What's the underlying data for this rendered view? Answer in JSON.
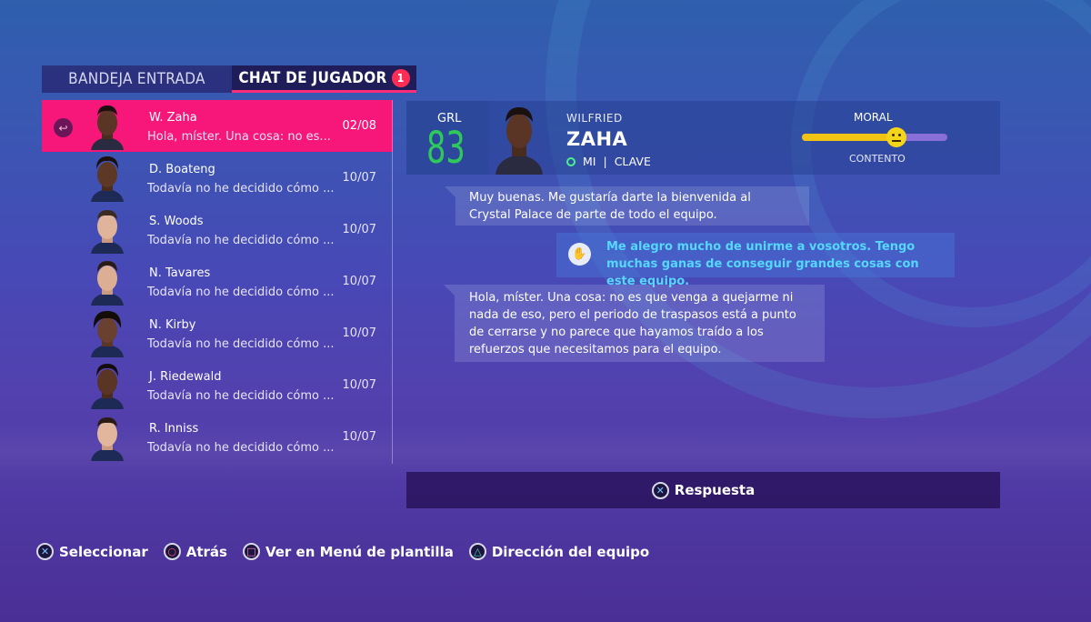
{
  "tabs": {
    "inbox": "BANDEJA ENTRADA",
    "chat": "CHAT DE JUGADOR",
    "chat_badge": "1"
  },
  "chats": [
    {
      "name": "W. Zaha",
      "preview": "Hola, míster. Una cosa: no es...",
      "date": "02/08",
      "active": true
    },
    {
      "name": "D. Boateng",
      "preview": "Todavía no he decidido cómo ...",
      "date": "10/07"
    },
    {
      "name": "S. Woods",
      "preview": "Todavía no he decidido cómo ...",
      "date": "10/07"
    },
    {
      "name": "N. Tavares",
      "preview": "Todavía no he decidido cómo ...",
      "date": "10/07"
    },
    {
      "name": "N. Kirby",
      "preview": "Todavía no he decidido cómo ...",
      "date": "10/07"
    },
    {
      "name": "J. Riedewald",
      "preview": "Todavía no he decidido cómo ...",
      "date": "10/07"
    },
    {
      "name": "R. Inniss",
      "preview": "Todavía no he decidido cómo ...",
      "date": "10/07"
    }
  ],
  "player": {
    "grl_label": "GRL",
    "grl_value": "83",
    "first_name": "WILFRIED",
    "last_name": "ZAHA",
    "position": "MI",
    "separator": "|",
    "role": "CLAVE",
    "morale_label": "MORAL",
    "morale_state": "CONTENTO",
    "morale_level": 0.65
  },
  "messages": {
    "m1": "Muy buenas. Me gustaría darte la bienvenida al Crystal Palace de parte de todo el equipo.",
    "m2": "Me alegro mucho de unirme a vosotros. Tengo muchas ganas de conseguir grandes cosas con este equipo.",
    "m3": "Hola, míster. Una cosa: no es que venga a quejarme ni nada de eso, pero el periodo de traspasos está a punto de cerrarse y no parece que hayamos traído a los refuerzos que necesitamos para el equipo."
  },
  "reply_label": "Respuesta",
  "footer": {
    "select": "Seleccionar",
    "back": "Atrás",
    "view": "Ver en Menú de plantilla",
    "direction": "Dirección del equipo"
  },
  "colors": {
    "accent": "#f7167a",
    "rating": "#2ec95a",
    "morale_fill": "#f1c312",
    "player_msg": "#55d7ff"
  }
}
